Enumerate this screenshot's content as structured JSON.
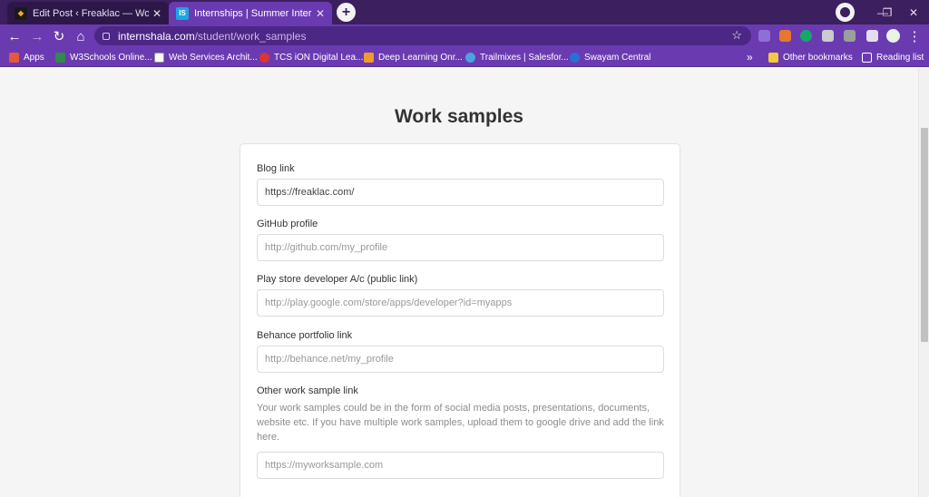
{
  "tabs": [
    {
      "title": "Edit Post ‹ Freaklac — WordPress",
      "close": "✕"
    },
    {
      "title": "Internships | Summer Internship",
      "close": "✕",
      "favicon": "IS"
    }
  ],
  "new_tab": "+",
  "window_controls": {
    "minimize": "—",
    "restore": "❐",
    "close": "✕"
  },
  "address_bar": {
    "host": "internshala.com",
    "path": "/student/work_samples"
  },
  "nav_icons": {
    "back": "←",
    "forward": "→",
    "reload": "↻",
    "home": "⌂",
    "menu": "⋮",
    "star": "☆"
  },
  "bookmarks": [
    {
      "label": "Apps"
    },
    {
      "label": "W3Schools Online..."
    },
    {
      "label": "Web Services Archit..."
    },
    {
      "label": "TCS iON Digital Lea..."
    },
    {
      "label": "Deep Learning Onr..."
    },
    {
      "label": "Trailmixes | Salesfor..."
    },
    {
      "label": "Swayam Central"
    }
  ],
  "bookmarks_overflow": "»",
  "other_bookmarks": "Other bookmarks",
  "reading_list": "Reading list",
  "page": {
    "title": "Work samples",
    "fields": [
      {
        "label": "Blog link",
        "value": "https://freaklac.com/",
        "placeholder": ""
      },
      {
        "label": "GitHub profile",
        "value": "",
        "placeholder": "http://github.com/my_profile"
      },
      {
        "label": "Play store developer A/c (public link)",
        "value": "",
        "placeholder": "http://play.google.com/store/apps/developer?id=myapps"
      },
      {
        "label": "Behance portfolio link",
        "value": "",
        "placeholder": "http://behance.net/my_profile"
      },
      {
        "label": "Other work sample link",
        "value": "",
        "placeholder": "https://myworksample.com",
        "help": "Your work samples could be in the form of social media posts, presentations, documents, website etc. If you have multiple work samples, upload them to google drive and add the link here."
      }
    ]
  },
  "colors": {
    "tab_strip": "#3c1f5e",
    "toolbar": "#6a3bb0",
    "omnibox": "#4c2785"
  }
}
